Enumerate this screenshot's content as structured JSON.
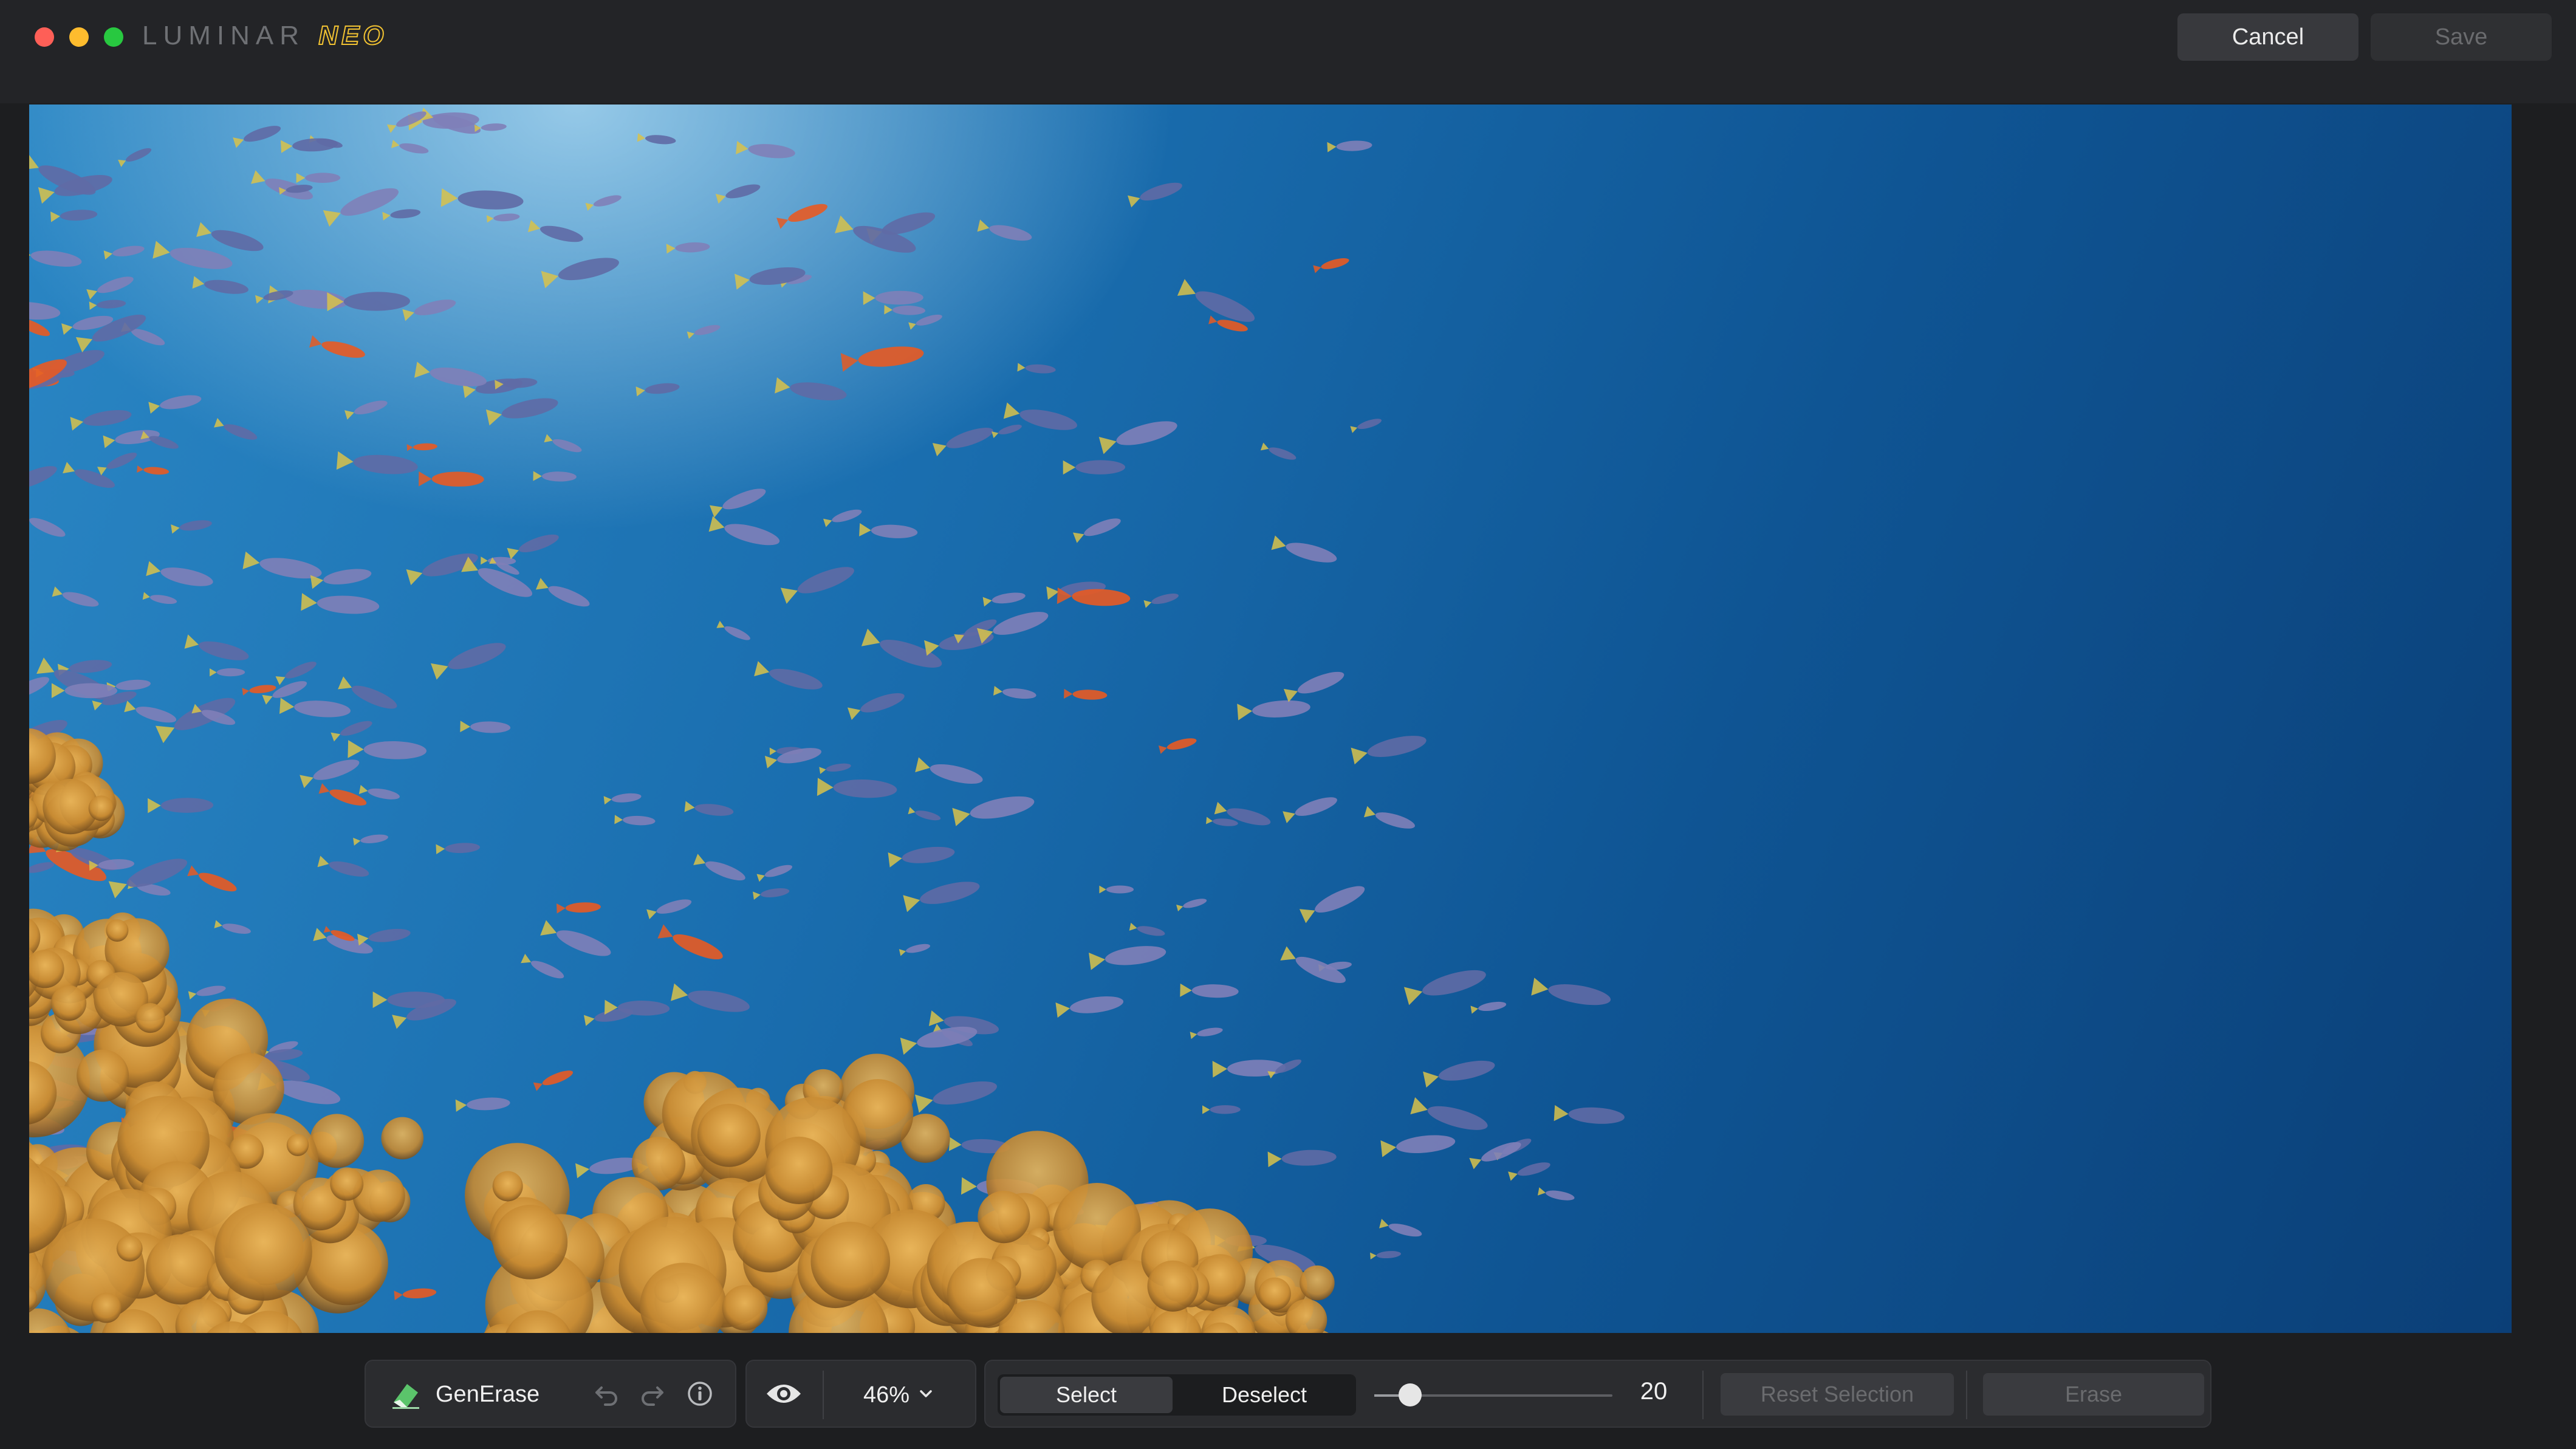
{
  "app": {
    "brand_main": "LUMINAR",
    "brand_accent": "NEO",
    "accent_color": "#f1c232"
  },
  "header": {
    "cancel_label": "Cancel",
    "save_label": "Save"
  },
  "tool": {
    "name": "GenErase",
    "icon": "eraser-icon"
  },
  "view": {
    "zoom_label": "46%",
    "preview_icon": "eye-icon"
  },
  "selection": {
    "select_label": "Select",
    "deselect_label": "Deselect",
    "active_mode": "Select",
    "brush_size": "20",
    "brush_size_fraction": 0.15,
    "reset_label": "Reset Selection",
    "erase_label": "Erase"
  },
  "colors": {
    "traffic_close": "#fe5f57",
    "traffic_minimize": "#febc2e",
    "traffic_maximize": "#28c840"
  }
}
